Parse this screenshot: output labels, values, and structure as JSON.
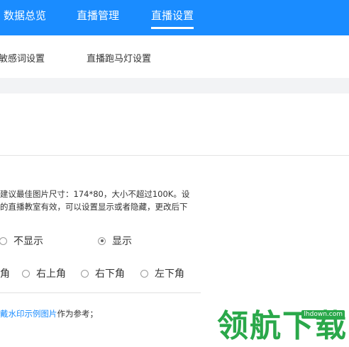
{
  "top_nav": {
    "tabs": [
      {
        "label": "数据总览",
        "active": false
      },
      {
        "label": "直播管理",
        "active": false
      },
      {
        "label": "直播设置",
        "active": true
      }
    ]
  },
  "sub_nav": {
    "tabs": [
      "敏感词设置",
      "直播跑马灯设置"
    ]
  },
  "hints": {
    "line1": "建议最佳图片尺寸：174*80，大小不超过100K。设",
    "line2": "的直播教室有效，可以设置显示或者隐藏，更改后下"
  },
  "display_options": [
    {
      "label": "不显示",
      "selected": false
    },
    {
      "label": "显示",
      "selected": true
    }
  ],
  "position_options": {
    "first_label": "角",
    "options": [
      {
        "label": "右上角",
        "selected": false
      },
      {
        "label": "右下角",
        "selected": false
      },
      {
        "label": "左下角",
        "selected": false
      }
    ]
  },
  "example": {
    "link_text": "戴水印示例图片",
    "suffix": "作为参考；"
  },
  "watermark": {
    "text": "领航下载",
    "domain": "lhdown.com",
    "color": "#2aa84a"
  },
  "colors": {
    "accent": "#1a8cff",
    "band": "#f2f3f5"
  }
}
